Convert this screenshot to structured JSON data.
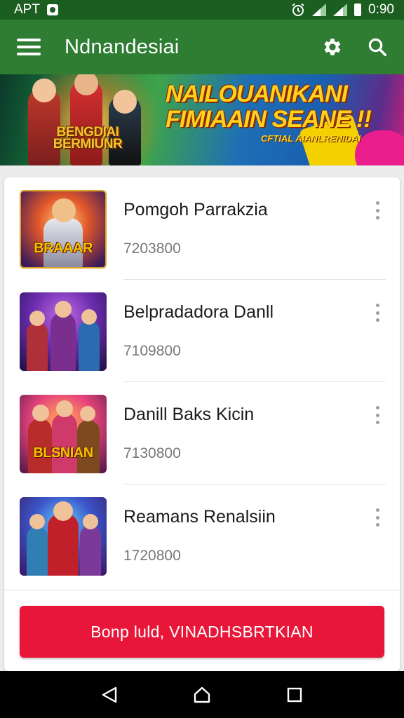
{
  "status_bar": {
    "carrier": "APT",
    "time": "0:90",
    "icons": [
      "app-notification-icon",
      "alarm-icon",
      "signal-icon",
      "signal-icon",
      "battery-icon"
    ]
  },
  "app_bar": {
    "title": "Ndnandesiai",
    "actions": [
      "settings-icon",
      "search-icon"
    ],
    "color": "#2e7d32"
  },
  "banner": {
    "logo_text": "BENGDIAI BERMIUNR",
    "headline": "NAILOUANIKANI FIMIAAIN SEANE !!",
    "subtext": "CFTIAL AIANLRENIDAI"
  },
  "list": {
    "items": [
      {
        "title": "Pomgoh Parrakzia",
        "subtitle": "7203800",
        "thumb_label": "BRAAAR"
      },
      {
        "title": "Belpradadora Danll",
        "subtitle": "7109800",
        "thumb_label": ""
      },
      {
        "title": "Danill Baks Kicin",
        "subtitle": "7130800",
        "thumb_label": "BLSNIAN"
      },
      {
        "title": "Reamans Renalsiin",
        "subtitle": "1720800",
        "thumb_label": ""
      }
    ]
  },
  "primary_button": {
    "label": "Bonp luld, VINADHSBRTKIAN",
    "color": "#e8173a"
  },
  "nav_bar": {
    "buttons": [
      "back-icon",
      "home-icon",
      "recents-icon"
    ]
  }
}
